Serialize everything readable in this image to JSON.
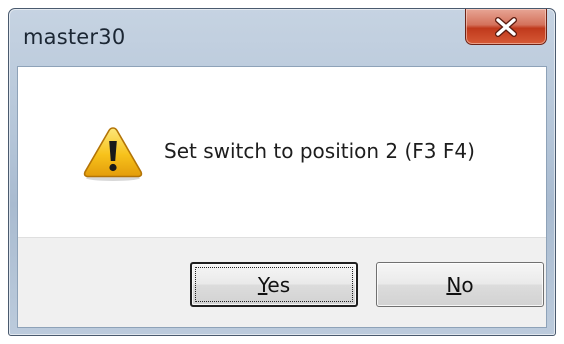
{
  "window": {
    "title": "master30"
  },
  "message": {
    "text": "Set switch to position 2 (F3 F4)",
    "icon": "warning-icon"
  },
  "buttons": {
    "yes": {
      "mnemonic": "Y",
      "rest": "es"
    },
    "no": {
      "mnemonic": "N",
      "rest": "o"
    }
  },
  "colors": {
    "close_button": "#c9462a",
    "warning_fill": "#f7c21b",
    "frame": "#b4c5d8"
  }
}
